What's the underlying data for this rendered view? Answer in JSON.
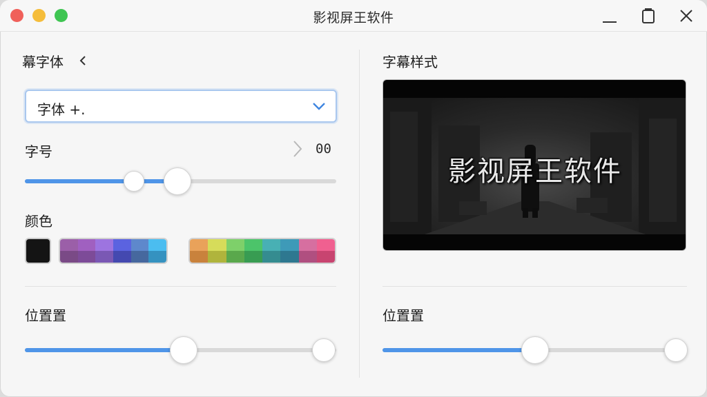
{
  "window": {
    "title": "影视屏王软件"
  },
  "left": {
    "font_section_label": "幕字体",
    "font_select_value": "字体 +.",
    "size_label": "字号",
    "size_value": "00",
    "size_slider_value": 0.49,
    "size_slider_marker": 0.35,
    "color_label": "颜色",
    "black_swatch_color": "#141414",
    "palette_cool": [
      [
        "#9b5fa8",
        "#7a4a86"
      ],
      [
        "#a060c0",
        "#7d4b98"
      ],
      [
        "#9d74e0",
        "#7a58b4"
      ],
      [
        "#5b63e0",
        "#4449b0"
      ],
      [
        "#5e88cc",
        "#46689e"
      ],
      [
        "#4bbdf0",
        "#3592c0"
      ]
    ],
    "palette_warm": [
      [
        "#e9a25a",
        "#c9823c"
      ],
      [
        "#d6dc5a",
        "#b0b43c"
      ],
      [
        "#7ed06a",
        "#5aa84c"
      ],
      [
        "#4cc46a",
        "#389c52"
      ],
      [
        "#48b0b4",
        "#358c90"
      ],
      [
        "#3e9ab8",
        "#2e7890"
      ],
      [
        "#d66fa0",
        "#b04f80"
      ],
      [
        "#f06090",
        "#c84470"
      ]
    ],
    "position_label": "位置置",
    "position_slider_value": 0.51
  },
  "right": {
    "style_label": "字幕样式",
    "preview_caption": "影视屏王软件",
    "position_label": "位置置",
    "position_slider_value": 0.5
  },
  "colors": {
    "accent": "#4f95e8",
    "track": "#d9d9d9"
  }
}
